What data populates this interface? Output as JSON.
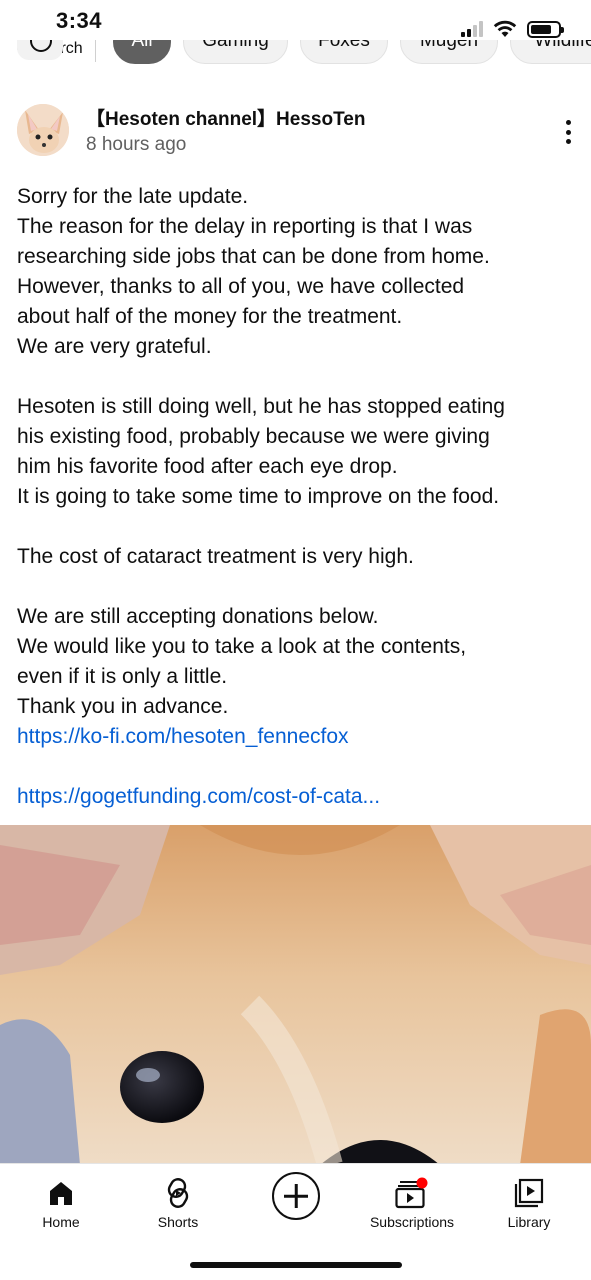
{
  "status_bar": {
    "time": "3:34",
    "back_label": "Search"
  },
  "chips": [
    "All",
    "Gaming",
    "Foxes",
    "Mugen",
    "Wildlife"
  ],
  "post": {
    "channel_name": "【Hesoten channel】HessoTen",
    "time_ago": "8 hours ago",
    "lines": [
      "Sorry for the late update.",
      "The reason for the delay in reporting is that I was",
      "researching side jobs that can be done from home.",
      "However, thanks to all of you, we have collected",
      "about half of the money for the treatment.",
      "We are very grateful.",
      "",
      "Hesoten is still doing well, but he has stopped eating",
      "his existing food, probably because we were giving",
      "him his favorite food after each eye drop.",
      "It is going to take some time to improve on the food.",
      "",
      "The cost of cataract treatment is very high.",
      "",
      "We are still accepting donations below.",
      "We would like you to take a look at the contents,",
      "even if it is only a little.",
      "Thank you in advance."
    ],
    "link1": "https://ko-fi.com/hesoten_fennecfox",
    "link2": "https://gogetfunding.com/cost-of-cata...",
    "link_color": "#065fd4"
  },
  "bottom_nav": {
    "home": "Home",
    "shorts": "Shorts",
    "subscriptions": "Subscriptions",
    "library": "Library",
    "notification_dot_color": "#ff0000"
  },
  "icons": [
    "back-triangle-icon",
    "signal-icon",
    "wifi-icon",
    "battery-icon",
    "explore-icon",
    "more-vert-icon",
    "home-icon",
    "shorts-icon",
    "create-icon",
    "subscriptions-icon",
    "library-icon"
  ]
}
